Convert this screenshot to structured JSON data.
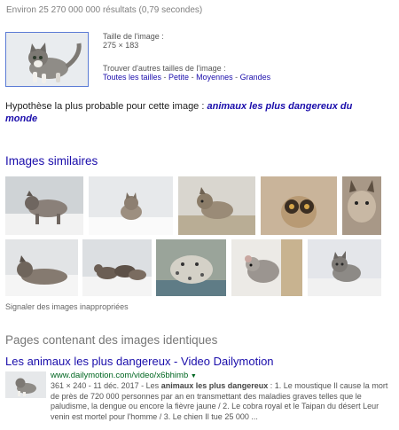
{
  "stats": "Environ 25 270 000 000 résultats (0,79 secondes)",
  "image_info": {
    "size_label": "Taille de l'image :",
    "size_value": "275 × 183",
    "find_label": "Trouver d'autres tailles de l'image :",
    "size_links": [
      "Toutes les tailles",
      "Petite",
      "Moyennes",
      "Grandes"
    ],
    "separator": " - "
  },
  "hypothesis": {
    "label": "Hypothèse la plus probable pour cette image :",
    "query": "animaux les plus dangereux du monde"
  },
  "similar": {
    "title": "Images similaires",
    "report_label": "Signaler des images inappropriées"
  },
  "pages": {
    "title": "Pages contenant des images identiques",
    "result": {
      "title": "Les animaux les plus dangereux - Video Dailymotion",
      "url": "www.dailymotion.com/video/x6bhimb",
      "meta": "361 × 240 - 11 déc. 2017 - Les",
      "meta_bold": "animaux les plus dangereux",
      "snippet": " : 1. Le moustique Il cause la mort de près de 720 000 personnes par an en transmettant des maladies graves telles que le paludisme, la dengue ou encore la fièvre jaune / 2. Le cobra royal et le Taipan du désert Leur venin est mortel pour l'homme / 3. Le chien Il tue 25 000 ..."
    }
  },
  "colors": {
    "link": "#1a0dab",
    "url_green": "#006621",
    "meta_gray": "#808080"
  }
}
